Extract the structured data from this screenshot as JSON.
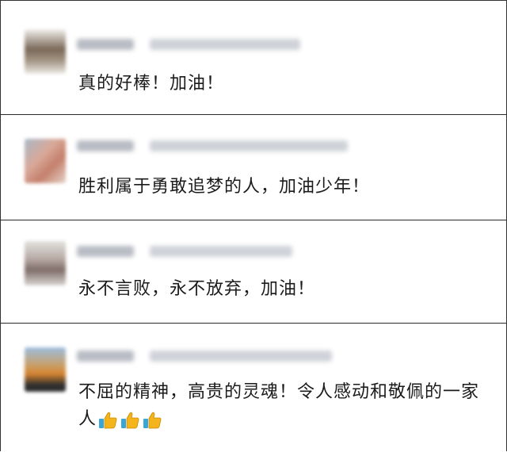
{
  "comments": [
    {
      "text": "真的好棒！加油！",
      "avatar_colors": [
        "#e9e6e2",
        "#6a5b4f",
        "#c9beb2"
      ]
    },
    {
      "text": "胜利属于勇敢追梦的人，加油少年！",
      "avatar_colors": [
        "#d7b7a8",
        "#c98f7d",
        "#9aa5b3"
      ]
    },
    {
      "text": "永不言败，永不放弃，加油！",
      "avatar_colors": [
        "#d8d8d4",
        "#9c8f8a",
        "#7e6f6b"
      ]
    },
    {
      "text": "不屈的精神，高贵的灵魂！令人感动和敬佩的一家人",
      "emoji": [
        "thumbs-up-icon",
        "thumbs-up-icon",
        "thumbs-up-icon"
      ],
      "avatar_colors": [
        "#8fb3d9",
        "#d08a3c",
        "#3b3b3b"
      ]
    }
  ],
  "colors": {
    "thumb": "#f5b41b",
    "cuff": "#3aa6d8"
  }
}
